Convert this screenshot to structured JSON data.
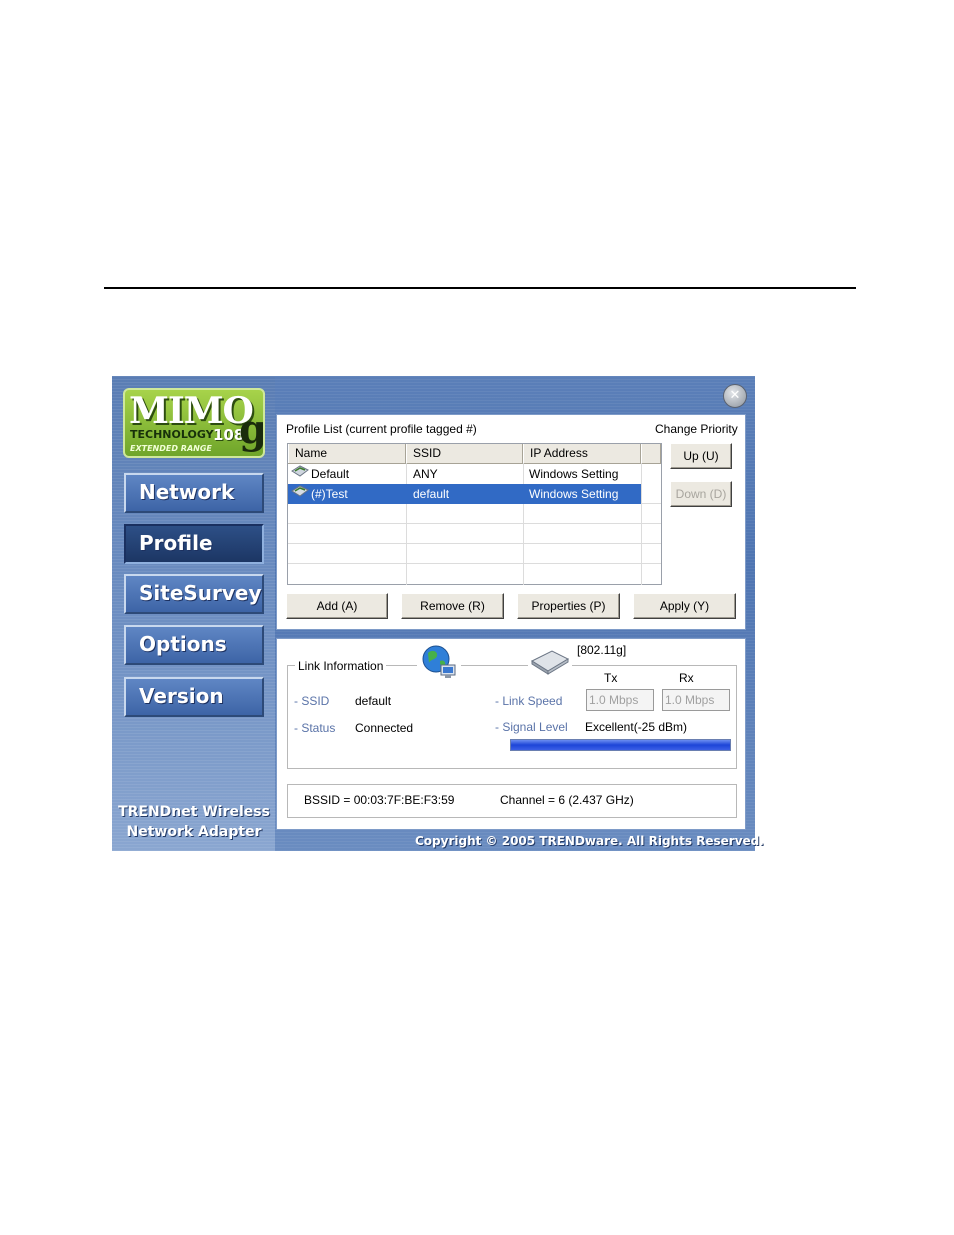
{
  "logo": {
    "mimo": "MIMO",
    "technology": "TECHNOLOGY",
    "extended_range": "EXTENDED RANGE",
    "speed": "108",
    "g": "g",
    "accent_color": "#8cc23c"
  },
  "nav": {
    "items": [
      {
        "label": "Network"
      },
      {
        "label": "Profile"
      },
      {
        "label": "SiteSurvey"
      },
      {
        "label": "Options"
      },
      {
        "label": "Version"
      }
    ],
    "active": "Profile"
  },
  "brand": {
    "line1": "TRENDnet Wireless",
    "line2": "Network Adapter"
  },
  "profile": {
    "title": "Profile List (current profile tagged #)",
    "change_priority": "Change Priority",
    "columns": [
      "Name",
      "SSID",
      "IP Address"
    ],
    "rows": [
      {
        "name": "Default",
        "ssid": "ANY",
        "ip": "Windows Setting",
        "selected": false
      },
      {
        "name": "(#)Test",
        "ssid": "default",
        "ip": "Windows Setting",
        "selected": true
      }
    ],
    "up_label": "Up (U)",
    "down_label": "Down (D)",
    "buttons": {
      "add": "Add (A)",
      "remove": "Remove (R)",
      "properties": "Properties (P)",
      "apply": "Apply (Y)"
    }
  },
  "link": {
    "group_title": "Link Information",
    "mode": "[802.11g]",
    "ssid_label": "- SSID",
    "ssid_value": "default",
    "status_label": "- Status",
    "status_value": "Connected",
    "tx_label": "Tx",
    "rx_label": "Rx",
    "link_speed_label": "- Link Speed",
    "tx_value": "1.0 Mbps",
    "rx_value": "1.0 Mbps",
    "signal_label": "- Signal Level",
    "signal_value": "Excellent(-25 dBm)",
    "signal_fill": 1.0,
    "bssid": "BSSID = 00:03:7F:BE:F3:59",
    "channel": "Channel = 6 (2.437 GHz)"
  },
  "copyright": "Copyright © 2005 TRENDware. All Rights Reserved.",
  "colors": {
    "selection": "#316ac5",
    "window_blue": "#4f75b2"
  }
}
